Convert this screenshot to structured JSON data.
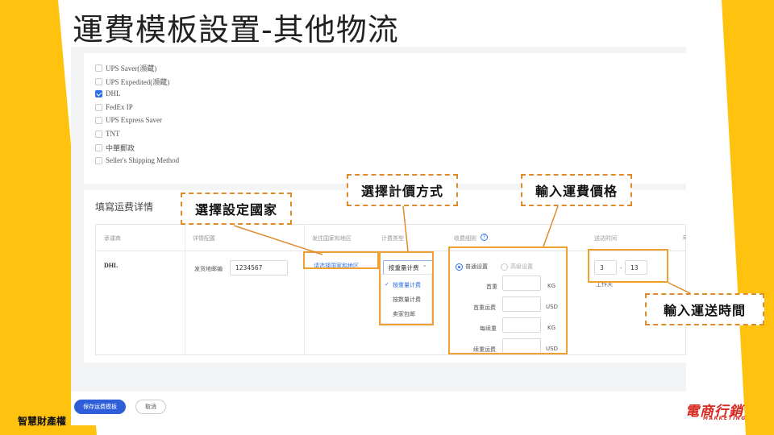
{
  "slide": {
    "title": "運費模板設置-其他物流",
    "caption": "智慧財產權",
    "logo_main": "電商行銷",
    "logo_sub": "MARKETING",
    "accent_color": "#FFC20E",
    "annotation_color": "#E08A2C"
  },
  "carriers": [
    {
      "label": "UPS Saver(濒蔵)",
      "checked": false
    },
    {
      "label": "UPS Expedited(濒蔵)",
      "checked": false
    },
    {
      "label": "DHL",
      "checked": true
    },
    {
      "label": "FedEx IP",
      "checked": false
    },
    {
      "label": "UPS Express Saver",
      "checked": false
    },
    {
      "label": "TNT",
      "checked": false
    },
    {
      "label": "中華郵政",
      "checked": false
    },
    {
      "label": "Seller's Shipping Method",
      "checked": false
    }
  ],
  "detail": {
    "title": "填寫运费详情",
    "headers": [
      "承運商",
      "详情配置",
      "发往国家和地区",
      "计费类型",
      "收费细则",
      "送达时间",
      "E"
    ],
    "carrier_name": "DHL",
    "zip_label": "发货地邮编",
    "zip_value": "1234567",
    "country_link": "请选择国家和地区",
    "billing_selected": "按重量计费",
    "billing_options": [
      "按重量计费",
      "按数量计费",
      "卖家包邮"
    ],
    "radio_standard": "普通设置",
    "radio_advanced": "高级设置",
    "fee_rows": [
      {
        "label": "首重",
        "unit": "KG"
      },
      {
        "label": "首重运费",
        "unit": "USD"
      },
      {
        "label": "每续重",
        "unit": "KG"
      },
      {
        "label": "续重运费",
        "unit": "USD"
      }
    ],
    "time_min": "3",
    "time_sep": "-",
    "time_max": "13",
    "time_unit": "工作天"
  },
  "footer": {
    "save_label": "保存运费模板",
    "cancel_label": "取消"
  },
  "annotations": {
    "country": "選擇設定國家",
    "billing": "選擇計價方式",
    "price": "輸入運費價格",
    "time": "輸入運送時間"
  }
}
